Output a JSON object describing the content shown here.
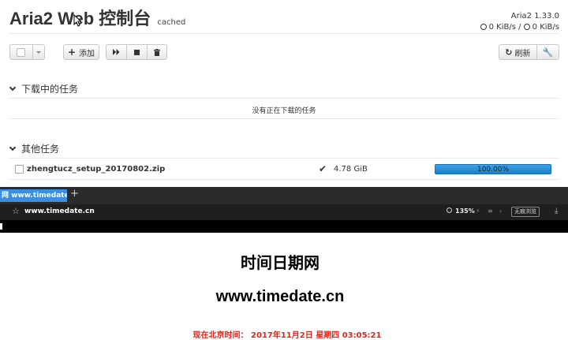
{
  "app": {
    "title": "Aria2 Web 控制台",
    "badge": "cached",
    "version": "Aria2 1.33.0",
    "download_speed": "0 KiB/s",
    "speed_separator": "/",
    "upload_speed": "0 KiB/s"
  },
  "toolbar": {
    "add_label": "添加",
    "refresh_label": "刷新"
  },
  "sections": {
    "downloading": {
      "title": "下载中的任务",
      "empty_text": "没有正在下载的任务"
    },
    "other": {
      "title": "其他任务"
    }
  },
  "tasks": [
    {
      "name": "zhengtucz_setup_20170802.zip",
      "size": "4.78 GiB",
      "progress_text": "100.00%",
      "progress": 1.0
    }
  ],
  "browser": {
    "tab_title": "网 www.timedate.c",
    "url": "www.timedate.cn",
    "zoom": "135%",
    "incognito_label": "无痕浏览"
  },
  "timedate": {
    "heading": "时间日期网",
    "site": "www.timedate.cn",
    "now_label": "现在北京时间：",
    "now_value": "2017年11月2日 星期四 03:05:21"
  },
  "colors": {
    "progress": "#1a7fc8",
    "tab_active": "#3b8fe0",
    "time_text": "#e0251b"
  }
}
